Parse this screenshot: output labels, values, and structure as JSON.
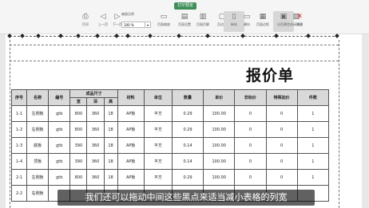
{
  "toolbar": {
    "mode_badge": "打印预览",
    "print": "打印",
    "prev_page": "上一页",
    "next_page": "下一页",
    "scale_label": "缩放比例",
    "scale_value": "100 %",
    "paper_size": "页面缩放",
    "page_setup": "页面设置",
    "header_footer": "页眉页脚",
    "margins": "页边距",
    "portrait": "纵向",
    "landscape": "横向",
    "paper_margin": "页面边距",
    "page_breaks": "分页预览",
    "close_preview": "关闭预览",
    "close": "关闭"
  },
  "sheet": {
    "title": "报价单",
    "headers": [
      "序号",
      "名称",
      "编号",
      "成品尺寸",
      "材料",
      "单位",
      "数量",
      "单价",
      "非标价",
      "特殊加价",
      "件数"
    ],
    "size_sub": [
      "宽",
      "深",
      "高"
    ],
    "rows": [
      [
        "1-1",
        "左侧板",
        "gtb",
        "800",
        "360",
        "18",
        "AP板",
        "平方",
        "0.29",
        "100.00",
        "0",
        "0",
        "1"
      ],
      [
        "1-2",
        "右侧板",
        "gtb",
        "800",
        "360",
        "18",
        "AP板",
        "平方",
        "0.29",
        "100.00",
        "0",
        "0",
        "1"
      ],
      [
        "1-3",
        "底板",
        "gtb",
        "390",
        "360",
        "18",
        "AP板",
        "平方",
        "0.14",
        "100.00",
        "0",
        "0",
        "1"
      ],
      [
        "1-4",
        "顶板",
        "gtb",
        "390",
        "360",
        "18",
        "AP板",
        "平方",
        "0.14",
        "100.00",
        "0",
        "0",
        "1"
      ],
      [
        "2-1",
        "左侧板",
        "gtb",
        "800",
        "360",
        "18",
        "AP板",
        "平方",
        "0.29",
        "100.00",
        "0",
        "0",
        "1"
      ],
      [
        "2-2",
        "右侧板",
        "",
        "",
        "",
        "",
        "",
        "",
        "",
        "",
        "",
        "",
        ""
      ]
    ]
  },
  "subtitle": "我们还可以拖动中间这些黑点来适当减小表格的列宽"
}
